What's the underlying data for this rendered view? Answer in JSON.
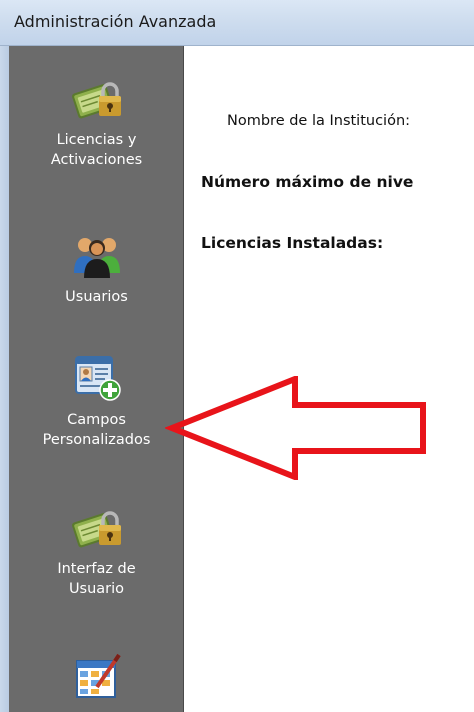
{
  "window": {
    "title": "Administración Avanzada"
  },
  "sidebar": {
    "items": [
      {
        "label": "Licencias y\nActivaciones",
        "icon": "license-lock-icon"
      },
      {
        "label": "Usuarios",
        "icon": "users-group-icon"
      },
      {
        "label": "Campos\nPersonalizados",
        "icon": "add-custom-field-icon"
      },
      {
        "label": "Interfaz de\nUsuario",
        "icon": "license-lock-icon"
      },
      {
        "label": "",
        "icon": "edit-grid-icon"
      }
    ]
  },
  "main": {
    "institution_name_label": "Nombre de la Institución:",
    "max_levels_label": "Número máximo de nive",
    "installed_licenses_label": "Licencias Instaladas:"
  },
  "annotation": {
    "arrow_color": "#e8141a",
    "arrow_points_to": "Campos Personalizados"
  },
  "colors": {
    "sidebar_bg": "#6b6b6b",
    "titlebar_bg": "#cddcee",
    "content_bg": "#ffffff"
  }
}
